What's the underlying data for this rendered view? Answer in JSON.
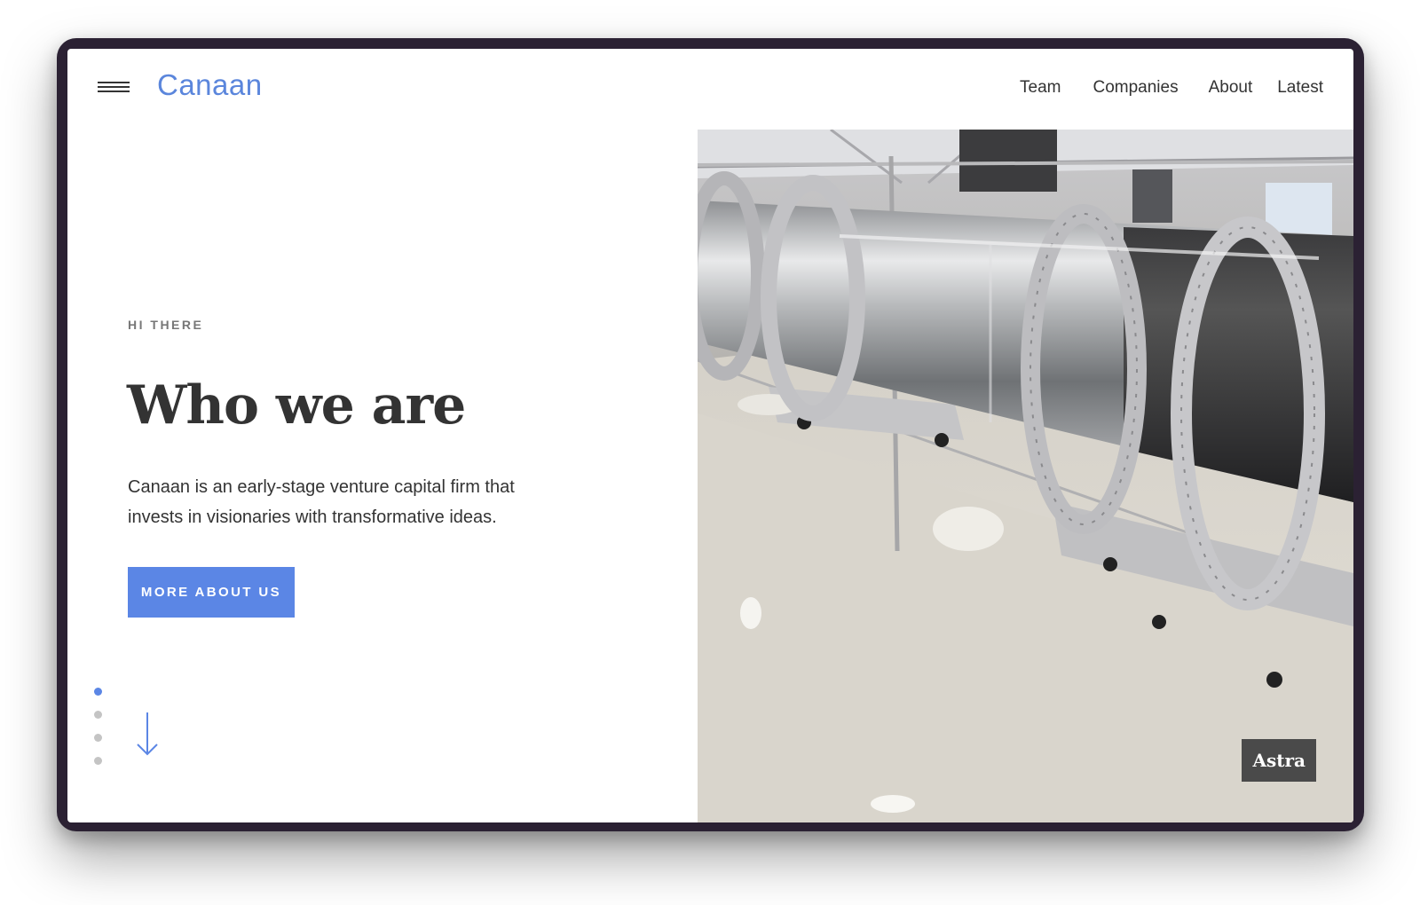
{
  "header": {
    "menu_icon": "hamburger-menu-icon",
    "logo": "Canaan",
    "nav": [
      {
        "label": "Team"
      },
      {
        "label": "Companies"
      },
      {
        "label": "About"
      },
      {
        "label": "Latest"
      }
    ]
  },
  "hero": {
    "eyebrow": "HI THERE",
    "title": "Who we are",
    "description": "Canaan is an early-stage venture capital firm that invests in visionaries with transformative ideas.",
    "cta_label": "MORE ABOUT US",
    "scroll_icon": "arrow-down-icon",
    "pagination": {
      "count": 4,
      "active": 1
    },
    "image_caption": "Astra"
  },
  "colors": {
    "accent": "#5b86e5",
    "text": "#333333",
    "eyebrow": "#777777",
    "frame": "#2b2133",
    "caption_bg": "#4a4a4a"
  }
}
